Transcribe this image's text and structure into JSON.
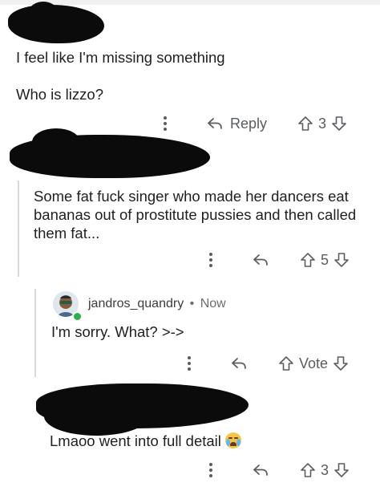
{
  "comments": [
    {
      "lines": [
        "I feel like I'm missing something",
        "",
        "Who is lizzo?"
      ],
      "actions": {
        "reply_label": "Reply",
        "score": "3"
      }
    },
    {
      "lines": [
        "Some fat fuck singer who made her dancers eat",
        "bananas out of prostitute pussies and then called",
        "them fat..."
      ],
      "actions": {
        "score": "5"
      }
    },
    {
      "username": "jandros_quandry",
      "separator": "•",
      "timestamp": "Now",
      "lines": [
        "I'm sorry. What? >->"
      ],
      "actions": {
        "vote_label": "Vote"
      }
    },
    {
      "lines": [
        "Lmaoo went into full detail"
      ],
      "emoji": "loudly-crying-face-emoji",
      "actions": {
        "score": "3"
      }
    }
  ],
  "colors": {
    "action_gray": "#5a5d60",
    "thread_line": "#d7dadc",
    "online": "#2bb14a"
  }
}
